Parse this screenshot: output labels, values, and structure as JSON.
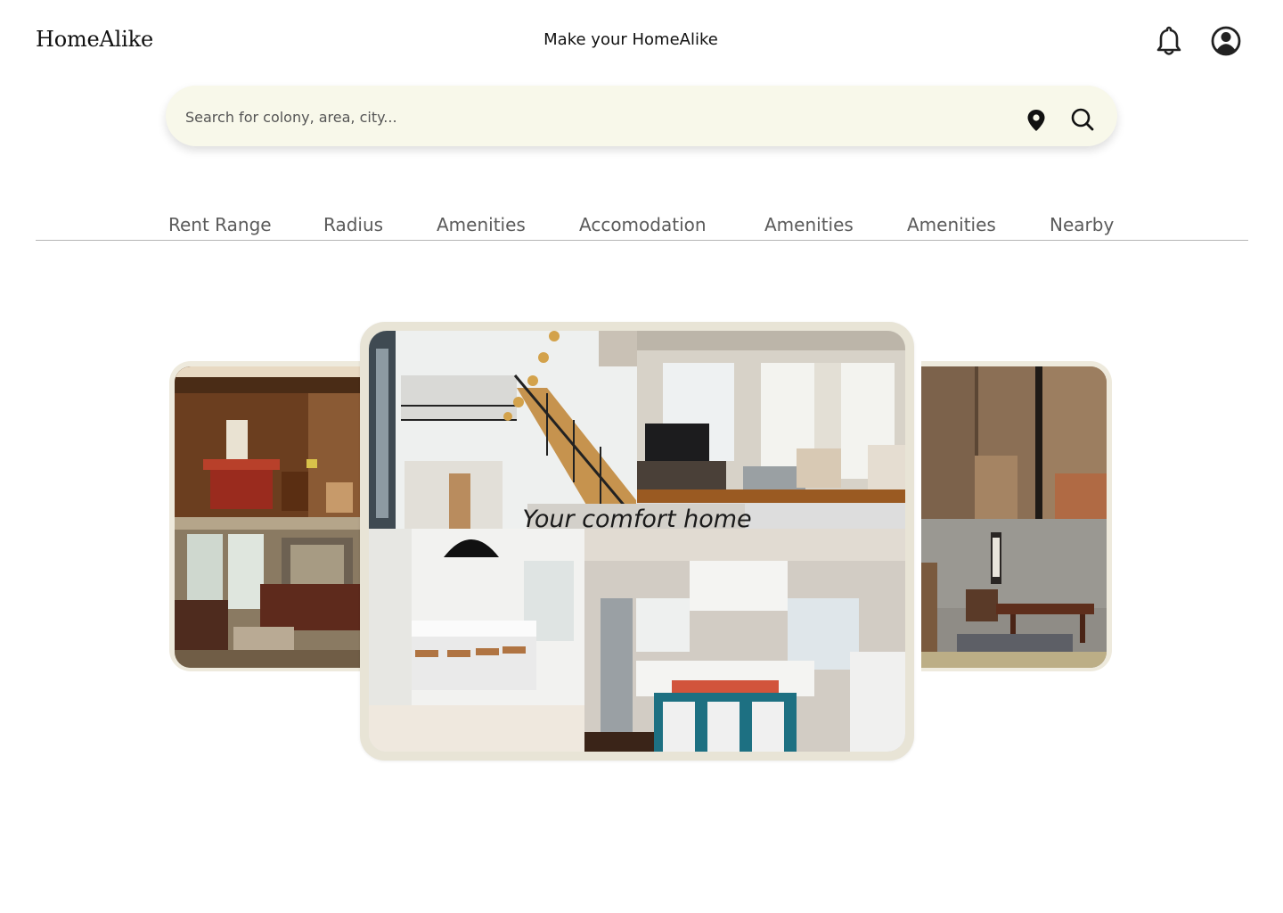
{
  "header": {
    "logo": "HomeAlike",
    "tagline": "Make your HomeAlike",
    "icons": [
      "bell-icon",
      "user-profile-icon"
    ]
  },
  "search": {
    "placeholder": "Search for colony, area, city...",
    "value": "",
    "icons": [
      "map-pin-icon",
      "search-icon"
    ]
  },
  "filters": [
    {
      "label": "Rent Range"
    },
    {
      "label": "Radius"
    },
    {
      "label": "Amenities"
    },
    {
      "label": "Accomodation"
    },
    {
      "label": "Amenities"
    },
    {
      "label": "Amenities"
    },
    {
      "label": "Nearby"
    }
  ],
  "carousel": {
    "caption": "Your comfort home"
  },
  "colors": {
    "search_bg": "#f8f8ea",
    "card_frame": "#e8e4d6",
    "filter_text": "#5b5b5b"
  }
}
